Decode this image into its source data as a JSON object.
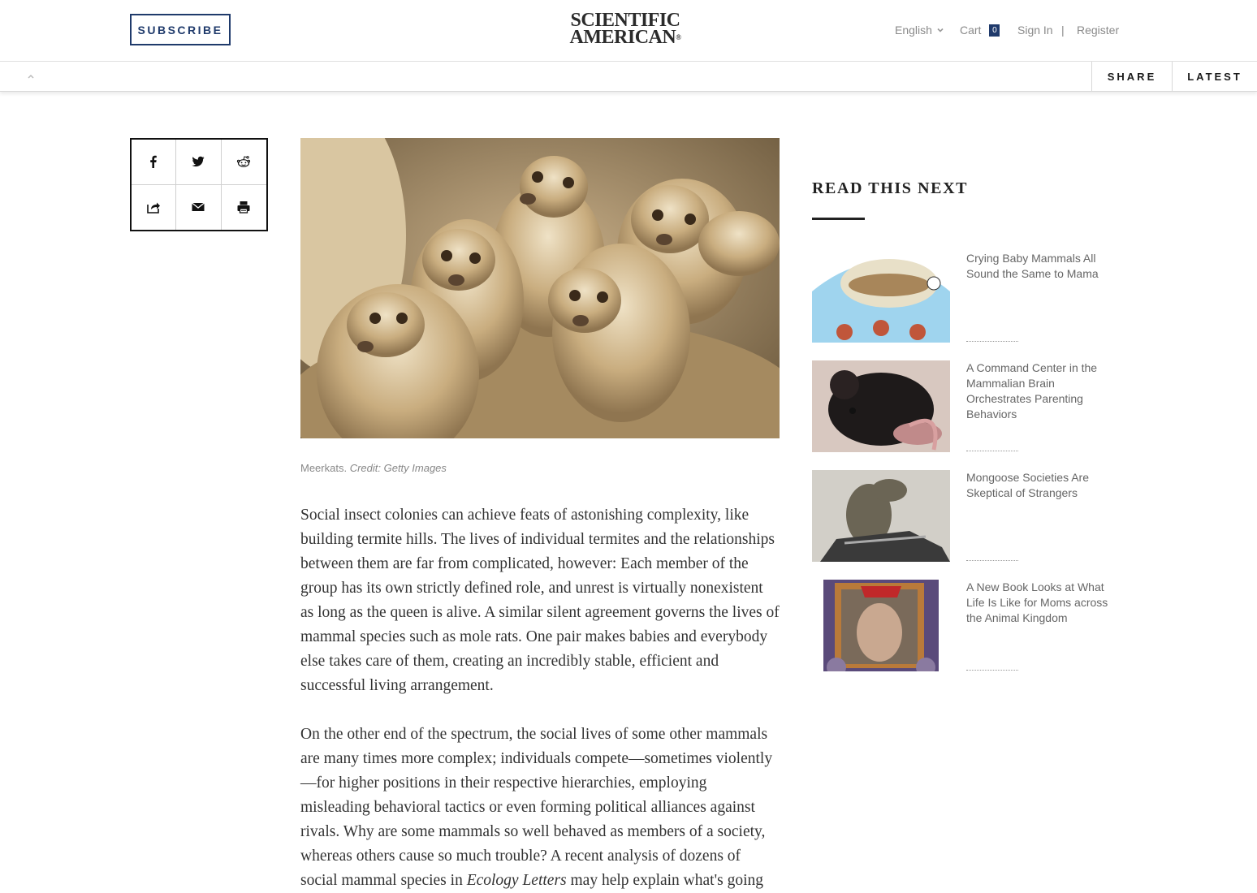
{
  "header": {
    "subscribe_label": "SUBSCRIBE",
    "logo_line1": "SCIENTIFIC",
    "logo_line2": "AMERICAN",
    "logo_mark": "®",
    "language": "English",
    "cart_label": "Cart",
    "cart_count": "0",
    "signin_label": "Sign In",
    "separator": "|",
    "register_label": "Register"
  },
  "subbar": {
    "share_label": "SHARE",
    "latest_label": "LATEST"
  },
  "share_icons": [
    "facebook-icon",
    "twitter-icon",
    "reddit-icon",
    "share-icon",
    "email-icon",
    "print-icon"
  ],
  "hero": {
    "caption": "Meerkats.",
    "credit": "Credit: Getty Images"
  },
  "article": {
    "p1": "Social insect colonies can achieve feats of astonishing complexity, like building termite hills. The lives of individual termites and the relationships between them are far from complicated, however: Each member of the group has its own strictly defined role, and unrest is virtually nonexistent as long as the queen is alive. A similar silent agreement governs the lives of mammal species such as mole rats. One pair makes babies and everybody else takes care of them, creating an incredibly stable, efficient and successful living arrangement.",
    "p2_start": "On the other end of the spectrum, the social lives of some other mammals are many times more complex; individuals compete—sometimes violently—for higher positions in their respective hierarchies, employing misleading behavioral tactics or even forming political alliances against rivals. Why are some mammals so well behaved as members of a society, whereas others cause so much trouble? A recent analysis of dozens of social mammal species in ",
    "p2_em": "Ecology Letters",
    "p2_end": " may help explain what's going"
  },
  "read_next": {
    "title": "READ THIS NEXT",
    "items": [
      {
        "title": "Crying Baby Mammals All Sound the Same to Mama"
      },
      {
        "title": "A Command Center in the Mammalian Brain Orchestrates Parenting Behaviors"
      },
      {
        "title": "Mongoose Societies Are Skeptical of Strangers"
      },
      {
        "title": "A New Book Looks at What Life Is Like for Moms across the Animal Kingdom"
      }
    ]
  },
  "colors": {
    "brand_navy": "#1f3a6b",
    "text_grey": "#8a8a8a"
  }
}
